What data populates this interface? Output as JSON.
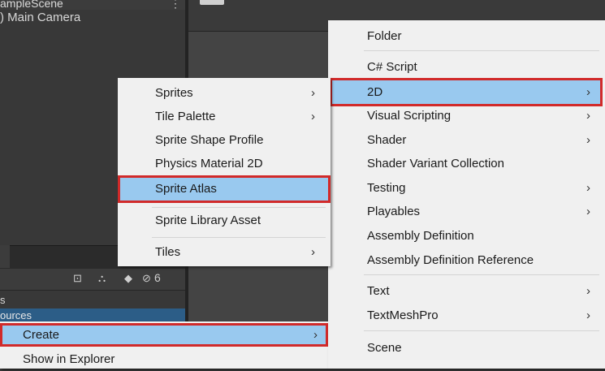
{
  "hierarchy": {
    "scene_title": "ampleScene",
    "kebab": "⋮",
    "items": [
      ") Main Camera"
    ]
  },
  "project": {
    "hidden_count": "6",
    "tree": {
      "assets": "s",
      "resources": "ources"
    }
  },
  "left_menu": {
    "items": [
      {
        "label": "Create",
        "submenu": true,
        "highlighted": true
      },
      {
        "label": "Show in Explorer",
        "submenu": false
      }
    ]
  },
  "create_menu": {
    "groups": [
      [
        {
          "label": "Folder",
          "submenu": false
        }
      ],
      [
        {
          "label": "C# Script",
          "submenu": false
        },
        {
          "label": "2D",
          "submenu": true,
          "highlighted": true
        },
        {
          "label": "Visual Scripting",
          "submenu": true
        },
        {
          "label": "Shader",
          "submenu": true
        },
        {
          "label": "Shader Variant Collection",
          "submenu": false
        },
        {
          "label": "Testing",
          "submenu": true
        },
        {
          "label": "Playables",
          "submenu": true
        },
        {
          "label": "Assembly Definition",
          "submenu": false
        },
        {
          "label": "Assembly Definition Reference",
          "submenu": false
        }
      ],
      [
        {
          "label": "Text",
          "submenu": true
        },
        {
          "label": "TextMeshPro",
          "submenu": true
        }
      ],
      [
        {
          "label": "Scene",
          "submenu": false
        }
      ]
    ]
  },
  "menu_2d": {
    "items": [
      {
        "label": "Sprites",
        "submenu": true
      },
      {
        "label": "Tile Palette",
        "submenu": true
      },
      {
        "label": "Sprite Shape Profile",
        "submenu": false
      },
      {
        "label": "Physics Material 2D",
        "submenu": false
      },
      {
        "label": "Sprite Atlas",
        "submenu": false,
        "highlighted": true
      },
      {
        "label": "Sprite Library Asset",
        "submenu": false
      },
      {
        "label": "Tiles",
        "submenu": true
      }
    ]
  },
  "icons": {
    "submenu_arrow": "›",
    "highlight_color": "#99c9ef",
    "callout_color": "#d12a2a"
  }
}
